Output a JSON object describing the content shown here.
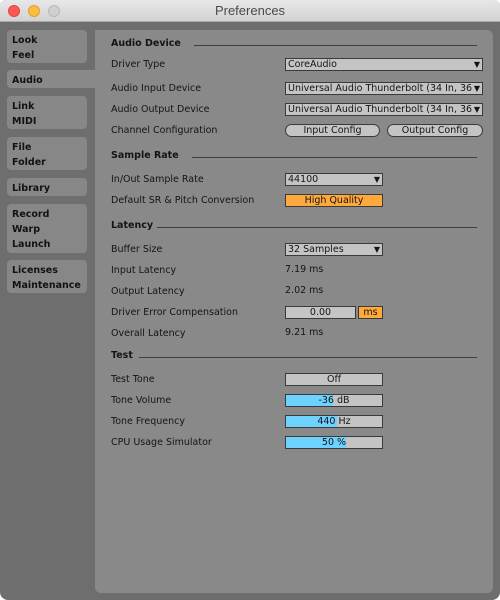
{
  "window": {
    "title": "Preferences"
  },
  "sidebar": {
    "tabs": [
      {
        "lines": [
          "Look",
          "Feel"
        ]
      },
      {
        "lines": [
          "Audio"
        ],
        "active": true
      },
      {
        "lines": [
          "Link",
          "MIDI"
        ]
      },
      {
        "lines": [
          "File",
          "Folder"
        ]
      },
      {
        "lines": [
          "Library"
        ]
      },
      {
        "lines": [
          "Record",
          "Warp",
          "Launch"
        ]
      },
      {
        "lines": [
          "Licenses",
          "Maintenance"
        ]
      }
    ]
  },
  "audio_device": {
    "heading": "Audio Device",
    "driver_type": {
      "label": "Driver Type",
      "value": "CoreAudio"
    },
    "input_device": {
      "label": "Audio Input Device",
      "value": "Universal Audio Thunderbolt (34 In, 36"
    },
    "output_device": {
      "label": "Audio Output Device",
      "value": "Universal Audio Thunderbolt (34 In, 36"
    },
    "channel_config": {
      "label": "Channel Configuration",
      "input_button": "Input Config",
      "output_button": "Output Config"
    }
  },
  "sample_rate": {
    "heading": "Sample Rate",
    "in_out": {
      "label": "In/Out Sample Rate",
      "value": "44100"
    },
    "conversion": {
      "label": "Default SR & Pitch Conversion",
      "value": "High Quality"
    }
  },
  "latency": {
    "heading": "Latency",
    "buffer_size": {
      "label": "Buffer Size",
      "value": "32 Samples"
    },
    "input_latency": {
      "label": "Input Latency",
      "value": "7.19 ms"
    },
    "output_latency": {
      "label": "Output Latency",
      "value": "2.02 ms"
    },
    "driver_error": {
      "label": "Driver Error Compensation",
      "value": "0.00",
      "unit": "ms"
    },
    "overall": {
      "label": "Overall Latency",
      "value": "9.21 ms"
    }
  },
  "test": {
    "heading": "Test",
    "test_tone": {
      "label": "Test Tone",
      "value": "Off"
    },
    "tone_volume": {
      "label": "Tone Volume",
      "value": "-36 dB",
      "fill": 0.49
    },
    "tone_frequency": {
      "label": "Tone Frequency",
      "value": "440 Hz",
      "fill": 0.53
    },
    "cpu_usage": {
      "label": "CPU Usage Simulator",
      "value": "50 %",
      "fill": 0.62
    }
  },
  "colors": {
    "accent_orange": "#ffa93c",
    "accent_blue": "#6ed2ff"
  }
}
